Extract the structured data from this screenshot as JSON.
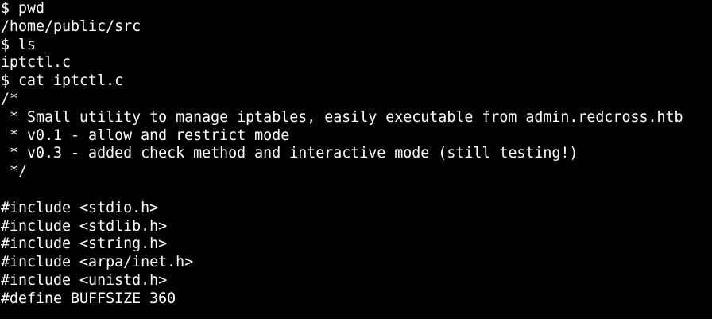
{
  "terminal": {
    "background": "#000000",
    "foreground": "#ffffff",
    "lines": [
      "$ pwd",
      "/home/public/src",
      "$ ls",
      "iptctl.c",
      "$ cat iptctl.c",
      "/*",
      " * Small utility to manage iptables, easily executable from admin.redcross.htb",
      " * v0.1 - allow and restrict mode",
      " * v0.3 - added check method and interactive mode (still testing!)",
      " */",
      "",
      "#include <stdio.h>",
      "#include <stdlib.h>",
      "#include <string.h>",
      "#include <arpa/inet.h>",
      "#include <unistd.h>",
      "#define BUFFSIZE 360"
    ]
  }
}
